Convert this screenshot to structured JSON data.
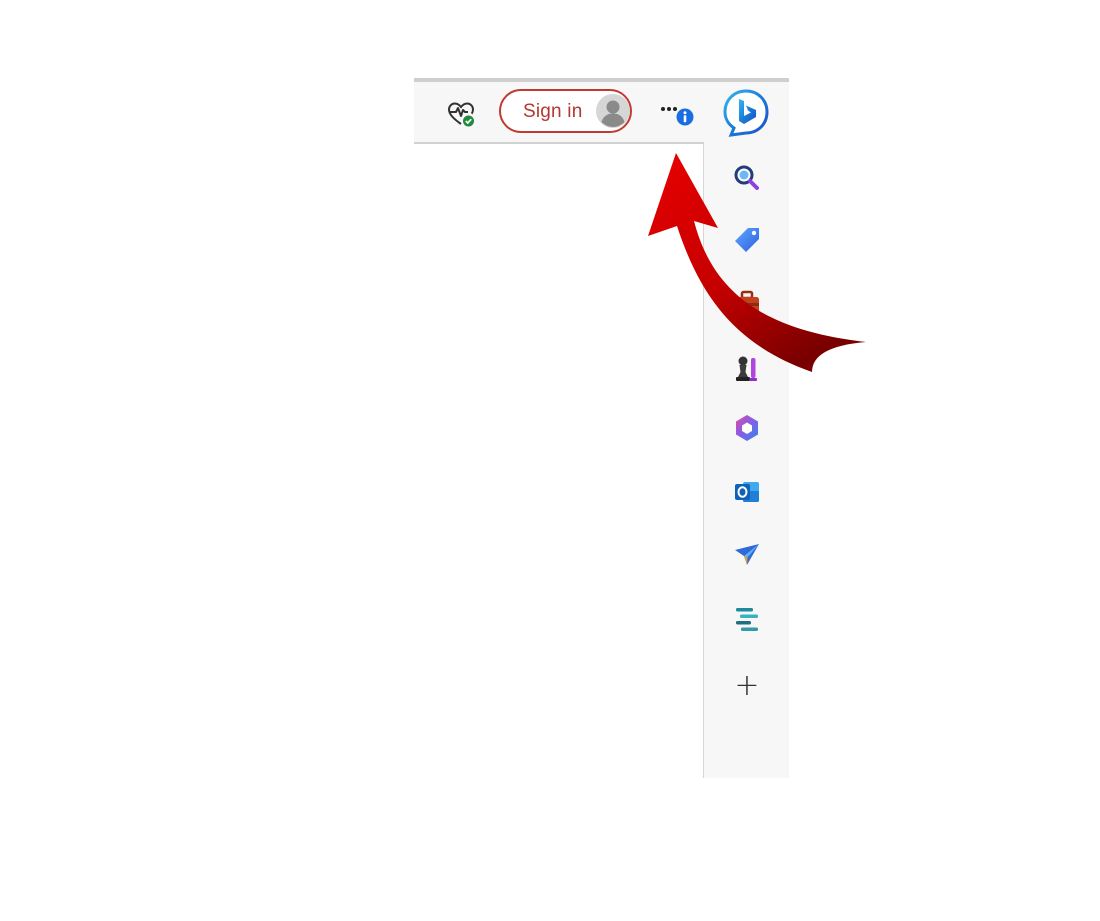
{
  "toolbar": {
    "signin_label": "Sign in",
    "health_icon": "heart-pulse-check-icon",
    "avatar_icon": "user-avatar-icon",
    "more_icon": "more-options-icon",
    "info_badge_icon": "info-badge-icon"
  },
  "sidebar": {
    "copilot_icon": "bing-copilot-icon",
    "items": [
      {
        "icon": "search-icon"
      },
      {
        "icon": "shopping-tag-icon"
      },
      {
        "icon": "tools-briefcase-icon"
      },
      {
        "icon": "games-chess-icon"
      },
      {
        "icon": "microsoft-365-icon"
      },
      {
        "icon": "outlook-icon"
      },
      {
        "icon": "drop-send-icon"
      },
      {
        "icon": "collections-icon"
      }
    ],
    "add_icon": "plus-icon",
    "add_glyph": "+"
  },
  "colors": {
    "signin_border": "#c03a32",
    "signin_text": "#b4372f",
    "arrow": "#d40000",
    "badge": "#1a6fe0"
  },
  "annotation": {
    "icon": "red-curved-arrow-icon"
  }
}
